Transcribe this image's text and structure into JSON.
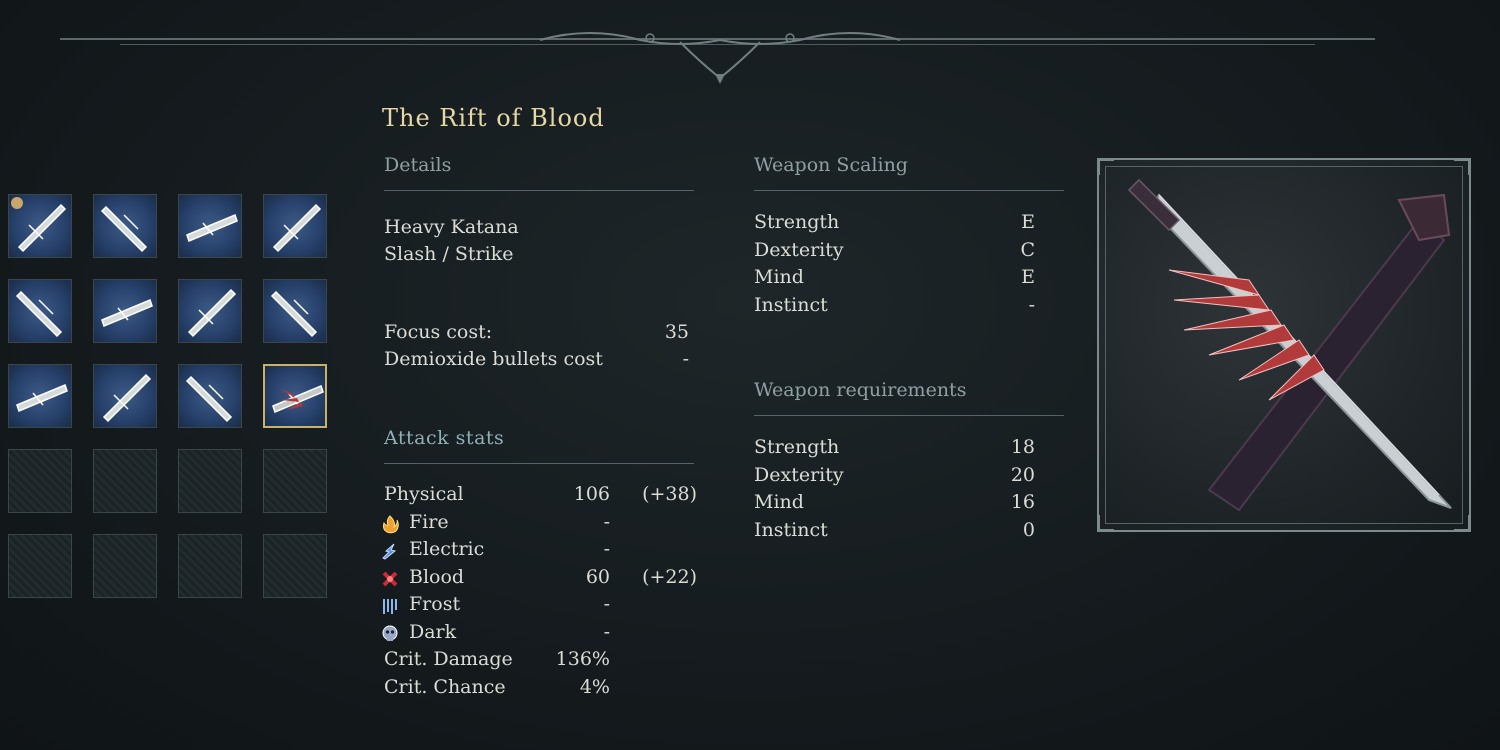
{
  "weapon": {
    "title": "The Rift of Blood"
  },
  "details": {
    "heading": "Details",
    "type": "Heavy Katana",
    "damage_type": "Slash / Strike",
    "focus_cost_label": "Focus cost:",
    "focus_cost_value": "35",
    "bullets_label": "Demioxide bullets cost",
    "bullets_value": "-"
  },
  "attack_stats": {
    "heading": "Attack stats",
    "rows": [
      {
        "label": "Physical",
        "value": "106",
        "bonus": "(+38)",
        "icon": null
      },
      {
        "label": "Fire",
        "value": "-",
        "bonus": "",
        "icon": "fire-icon"
      },
      {
        "label": "Electric",
        "value": "-",
        "bonus": "",
        "icon": "electric-icon"
      },
      {
        "label": "Blood",
        "value": "60",
        "bonus": "(+22)",
        "icon": "blood-icon"
      },
      {
        "label": "Frost",
        "value": "-",
        "bonus": "",
        "icon": "frost-icon"
      },
      {
        "label": "Dark",
        "value": "-",
        "bonus": "",
        "icon": "dark-icon"
      },
      {
        "label": "Crit. Damage",
        "value": "136%",
        "bonus": "",
        "icon": null
      },
      {
        "label": "Crit. Chance",
        "value": "4%",
        "bonus": "",
        "icon": null
      }
    ]
  },
  "scaling": {
    "heading": "Weapon Scaling",
    "rows": [
      {
        "label": "Strength",
        "value": "E"
      },
      {
        "label": "Dexterity",
        "value": "C"
      },
      {
        "label": "Mind",
        "value": "E"
      },
      {
        "label": "Instinct",
        "value": "-"
      }
    ]
  },
  "requirements": {
    "heading": "Weapon requirements",
    "rows": [
      {
        "label": "Strength",
        "value": "18"
      },
      {
        "label": "Dexterity",
        "value": "20"
      },
      {
        "label": "Mind",
        "value": "16"
      },
      {
        "label": "Instinct",
        "value": "0"
      }
    ]
  },
  "inventory": {
    "slots": [
      {
        "filled": true,
        "badge": true,
        "selected": false
      },
      {
        "filled": true,
        "badge": false,
        "selected": false
      },
      {
        "filled": true,
        "badge": false,
        "selected": false
      },
      {
        "filled": true,
        "badge": false,
        "selected": false
      },
      {
        "filled": true,
        "badge": false,
        "selected": false
      },
      {
        "filled": true,
        "badge": false,
        "selected": false
      },
      {
        "filled": true,
        "badge": false,
        "selected": false
      },
      {
        "filled": true,
        "badge": false,
        "selected": false
      },
      {
        "filled": true,
        "badge": false,
        "selected": false
      },
      {
        "filled": true,
        "badge": false,
        "selected": false
      },
      {
        "filled": true,
        "badge": false,
        "selected": false
      },
      {
        "filled": true,
        "badge": false,
        "selected": true
      },
      {
        "filled": false,
        "badge": false,
        "selected": false
      },
      {
        "filled": false,
        "badge": false,
        "selected": false
      },
      {
        "filled": false,
        "badge": false,
        "selected": false
      },
      {
        "filled": false,
        "badge": false,
        "selected": false
      },
      {
        "filled": false,
        "badge": false,
        "selected": false
      },
      {
        "filled": false,
        "badge": false,
        "selected": false
      },
      {
        "filled": false,
        "badge": false,
        "selected": false
      },
      {
        "filled": false,
        "badge": false,
        "selected": false
      }
    ]
  },
  "colors": {
    "title": "#e6d7a7",
    "selected_border": "#c8b26a",
    "blood_accent": "#b33a3a"
  }
}
